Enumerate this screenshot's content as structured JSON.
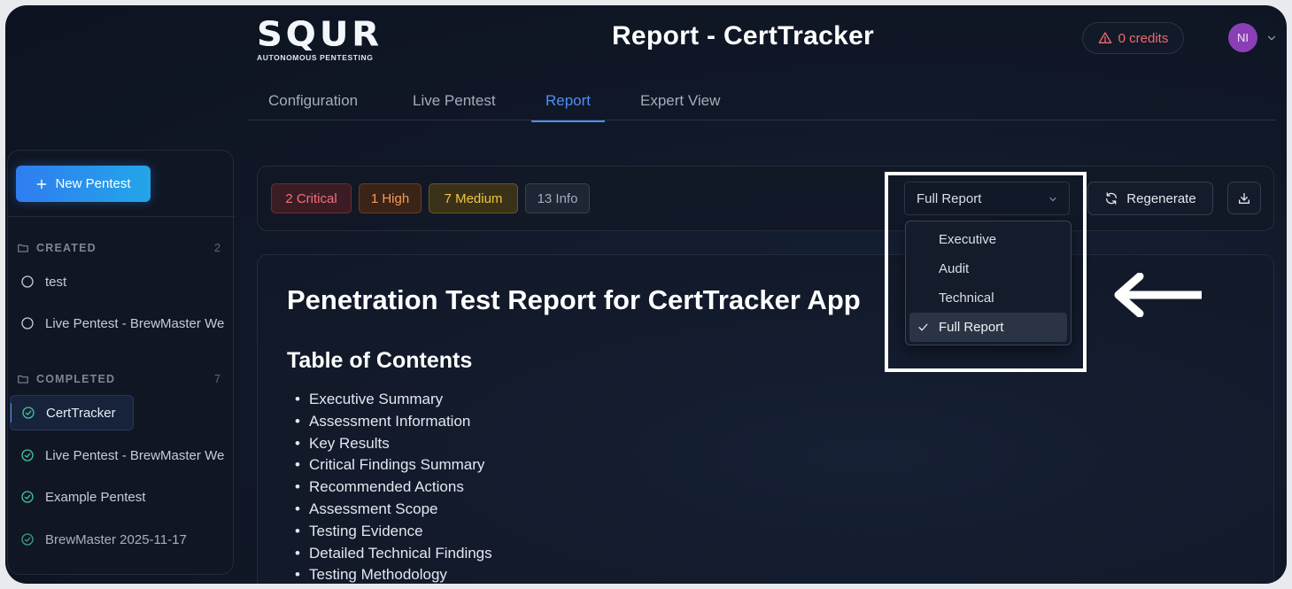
{
  "header": {
    "logo": {
      "word": "SQUR",
      "tagline": "AUTONOMOUS PENTESTING"
    },
    "title": "Report - CertTracker",
    "credits_label": "0 credits",
    "avatar_initials": "NI"
  },
  "tabs": [
    {
      "label": "Configuration",
      "active": false
    },
    {
      "label": "Live Pentest",
      "active": false
    },
    {
      "label": "Report",
      "active": true
    },
    {
      "label": "Expert View",
      "active": false
    }
  ],
  "sidebar": {
    "new_button_label": "New Pentest",
    "created": {
      "label": "CREATED",
      "count": "2",
      "items": [
        "test",
        "Live Pentest - BrewMaster We"
      ]
    },
    "completed": {
      "label": "COMPLETED",
      "count": "7",
      "items": [
        "CertTracker",
        "Live Pentest - BrewMaster We",
        "Example Pentest",
        "BrewMaster 2025-11-17"
      ]
    }
  },
  "toolbar": {
    "badges": {
      "critical": "2 Critical",
      "high": "1 High",
      "medium": "7 Medium",
      "info": "13 Info"
    },
    "report_type_selected": "Full Report",
    "regenerate_label": "Regenerate"
  },
  "dropdown": {
    "options": [
      "Executive",
      "Audit",
      "Technical",
      "Full Report"
    ],
    "selected": "Full Report"
  },
  "report": {
    "title": "Penetration Test Report for CertTracker App",
    "toc_title": "Table of Contents",
    "toc": [
      "Executive Summary",
      "Assessment Information",
      "Key Results",
      "Critical Findings Summary",
      "Recommended Actions",
      "Assessment Scope",
      "Testing Evidence",
      "Detailed Technical Findings",
      "Testing Methodology"
    ]
  },
  "colors": {
    "accent": "#4e8ff6",
    "critical": "#f0707a",
    "high": "#f59a5b",
    "medium": "#f1c541",
    "credits_warning": "#f06a6a",
    "avatar": "#8b3fb6"
  }
}
